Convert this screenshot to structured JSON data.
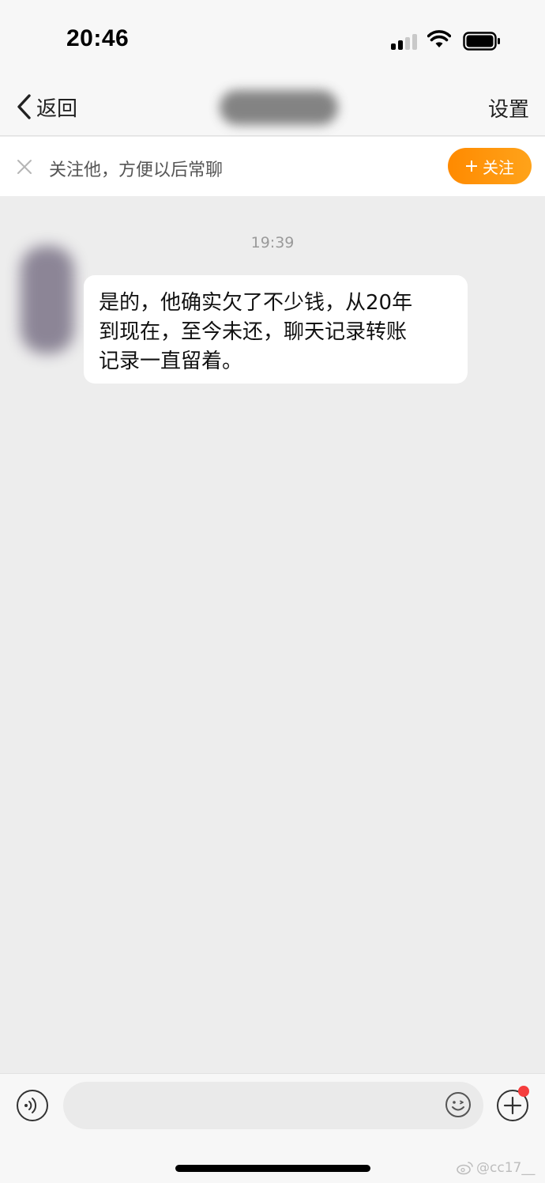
{
  "status_bar": {
    "time": "20:46",
    "signal_icon": "cellular-signal-icon",
    "wifi_icon": "wifi-icon",
    "battery_icon": "battery-icon"
  },
  "nav": {
    "back_label": "返回",
    "settings_label": "设置",
    "title_obscured": true
  },
  "follow_banner": {
    "text": "关注他，方便以后常聊",
    "button_label": "关注",
    "accent_color": "#ff8a00"
  },
  "chat": {
    "timestamp": "19:39",
    "messages": [
      {
        "sender": "other",
        "lines": [
          "是的，他确实欠了不少钱，从20年",
          "到现在，至今未还，聊天记录转账",
          "记录一直留着。"
        ]
      }
    ]
  },
  "input_bar": {
    "placeholder": "",
    "voice_icon": "voice-icon",
    "emoji_icon": "emoji-icon",
    "plus_icon": "plus-circle-icon",
    "notification_color": "#f53d3d"
  },
  "watermark": {
    "text": "@cc17__"
  }
}
